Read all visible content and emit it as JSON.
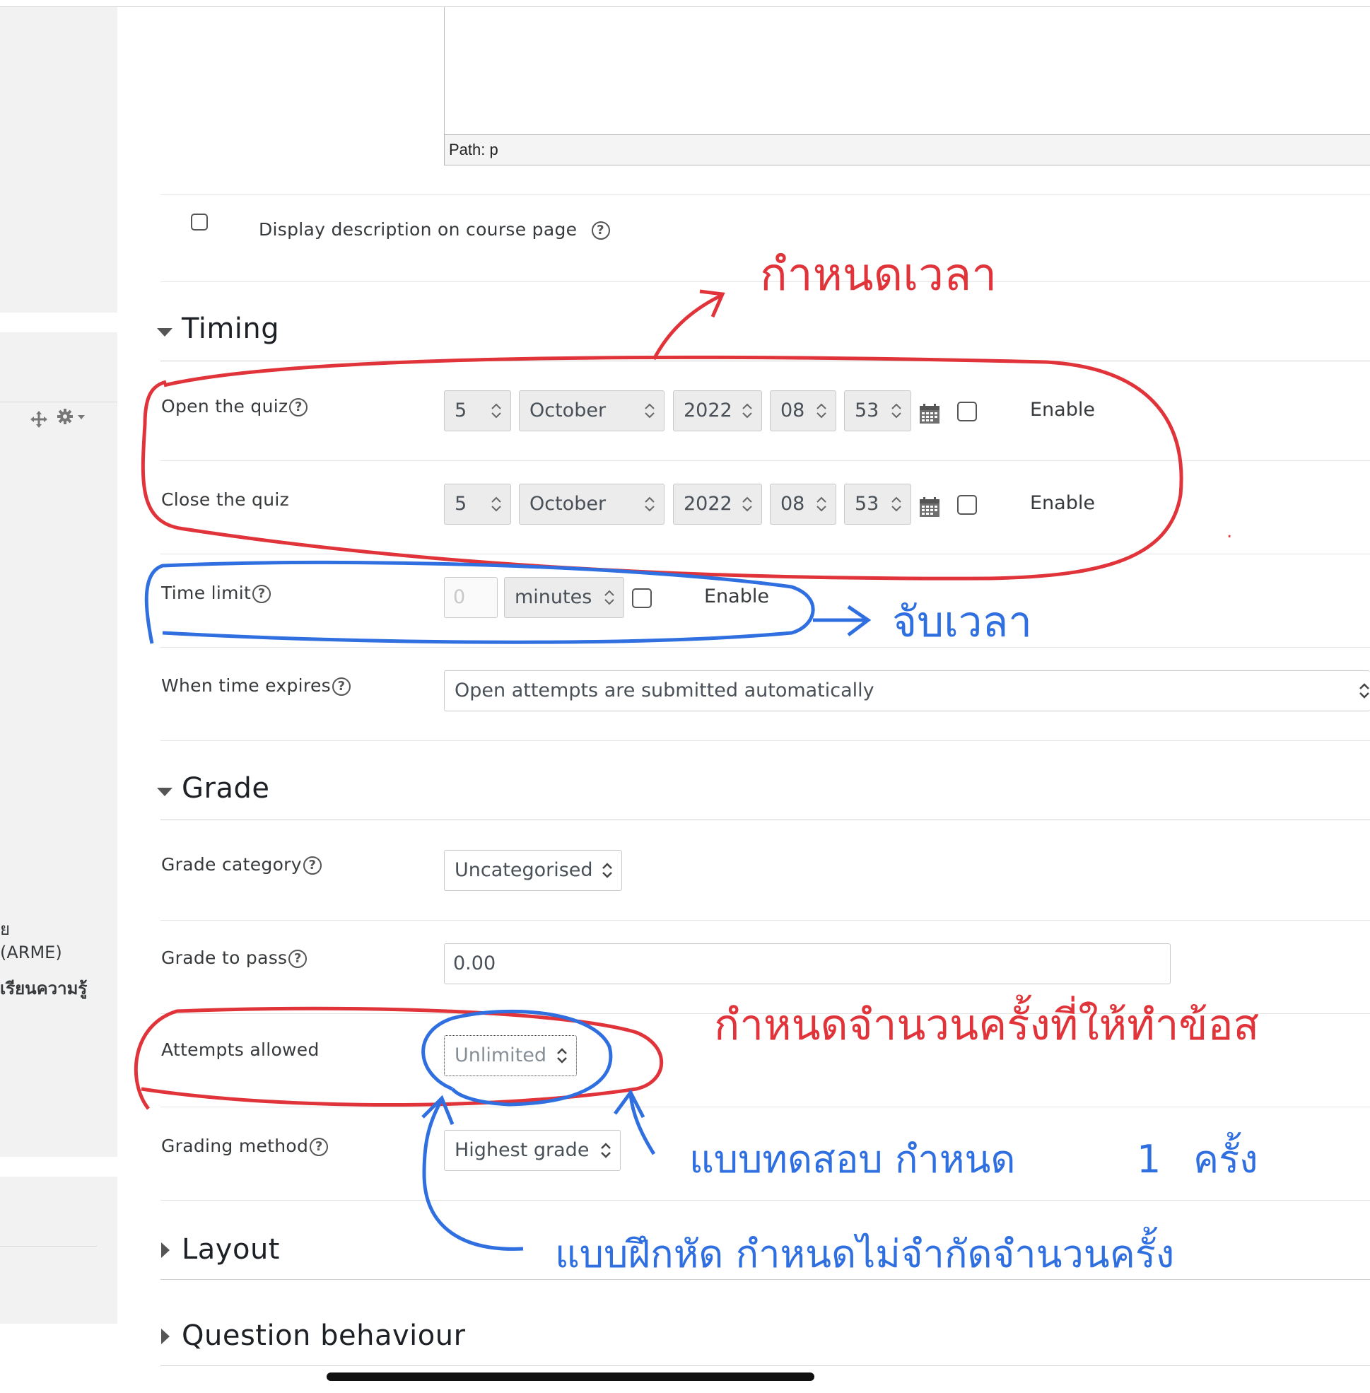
{
  "editor": {
    "path_label": "Path: p"
  },
  "display_description": {
    "label": "Display description on course page"
  },
  "timing": {
    "title": "Timing",
    "open": {
      "label": "Open the quiz",
      "day": "5",
      "month": "October",
      "year": "2022",
      "hour": "08",
      "minute": "53",
      "enable": "Enable"
    },
    "close": {
      "label": "Close the quiz",
      "day": "5",
      "month": "October",
      "year": "2022",
      "hour": "08",
      "minute": "53",
      "enable": "Enable"
    },
    "time_limit": {
      "label": "Time limit",
      "value_placeholder": "0",
      "unit": "minutes",
      "enable": "Enable"
    },
    "when_expires": {
      "label": "When time expires",
      "value": "Open attempts are submitted automatically"
    }
  },
  "grade": {
    "title": "Grade",
    "category": {
      "label": "Grade category",
      "value": "Uncategorised"
    },
    "to_pass": {
      "label": "Grade to pass",
      "value": "0.00"
    },
    "attempts": {
      "label": "Attempts allowed",
      "value": "Unlimited"
    },
    "method": {
      "label": "Grading method",
      "value": "Highest grade"
    }
  },
  "layout": {
    "title": "Layout"
  },
  "question_behaviour": {
    "title": "Question behaviour"
  },
  "sidebar": {
    "line1": "ย",
    "line2": "(ARME)",
    "line3": "เรียนความรู้"
  },
  "annotations": {
    "red_top": "กำหนดเวลา",
    "blue_time": "จับเวลา",
    "red_attempts": "กำหนดจำนวนครั้งที่ให้ทำข้อส",
    "blue_test": "แบบทดสอบ กำหนด",
    "blue_test_num": "1",
    "blue_test_unit": "ครั้ง",
    "blue_practice": "แบบฝึกหัด กำหนดไม่จำกัดจำนวนครั้ง"
  },
  "colors": {
    "annotation_red": "#e0343a",
    "annotation_blue": "#2f6fe0"
  }
}
